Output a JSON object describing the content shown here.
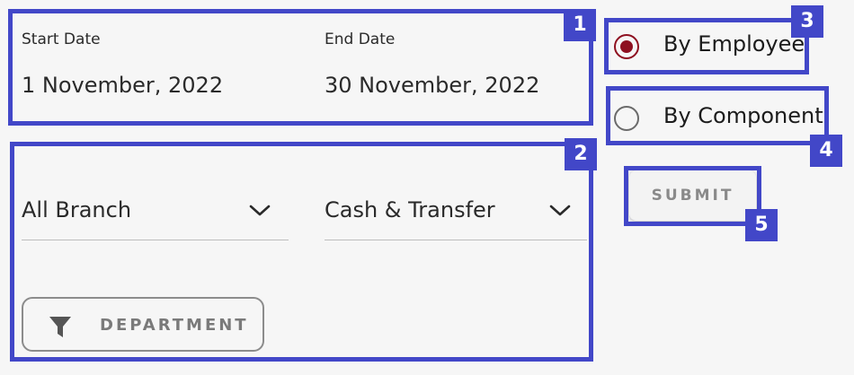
{
  "dates": {
    "start_label": "Start Date",
    "start_value": "1 November, 2022",
    "end_label": "End Date",
    "end_value": "30 November, 2022"
  },
  "filters": {
    "branch_value": "All Branch",
    "payment_value": "Cash & Transfer",
    "department_label": "DEPARTMENT"
  },
  "report_type": {
    "options": [
      {
        "label": "By Employee",
        "selected": true
      },
      {
        "label": "By Component",
        "selected": false
      }
    ]
  },
  "actions": {
    "submit_label": "SUBMIT"
  },
  "annotations": {
    "badges": [
      "1",
      "2",
      "3",
      "4",
      "5"
    ],
    "color": "#4247c8"
  },
  "colors": {
    "accent": "#8e1020",
    "background": "#f6f6f6",
    "muted_text": "#7a7a7a"
  },
  "icons": {
    "select_caret": "chevron-down-icon",
    "department": "funnel-icon"
  }
}
